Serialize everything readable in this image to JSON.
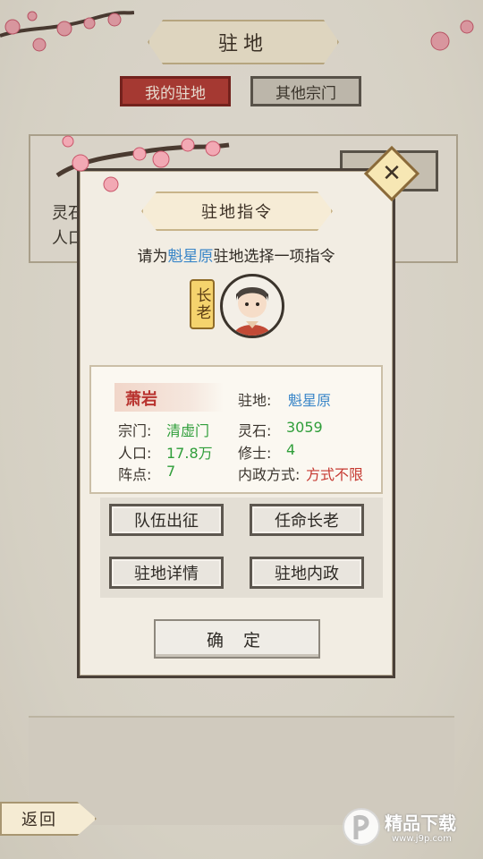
{
  "header": {
    "title": "驻地"
  },
  "tabs": [
    {
      "label": "我的驻地",
      "active": true
    },
    {
      "label": "其他宗门",
      "active": false
    }
  ],
  "background_card": {
    "line1": "灵石",
    "line2": "人口"
  },
  "dialog": {
    "title": "驻地指令",
    "prompt_prefix": "请为",
    "prompt_place": "魁星原",
    "prompt_suffix": "驻地选择一项指令",
    "rank_tag": "长老",
    "info": {
      "name": "萧岩",
      "station_label": "驻地:",
      "station_value": "魁星原",
      "sect_label": "宗门:",
      "sect_value": "清虚门",
      "stone_label": "灵石:",
      "stone_value": "3059",
      "pop_label": "人口:",
      "pop_value": "17.8万",
      "cult_label": "修士:",
      "cult_value": "4",
      "formation_label": "阵点:",
      "formation_value": "7",
      "policy_label": "内政方式:",
      "policy_value": "方式不限"
    },
    "actions": [
      "队伍出征",
      "任命长老",
      "驻地详情",
      "驻地内政"
    ],
    "confirm_label": "确 定"
  },
  "footer": {
    "back_label": "返回"
  },
  "watermark": {
    "brand": "精品下载",
    "domain": "www.j9p.com"
  },
  "colors": {
    "accent_red": "#b43a33",
    "accent_blue": "#3a86c8",
    "accent_green": "#2f9e3a"
  }
}
